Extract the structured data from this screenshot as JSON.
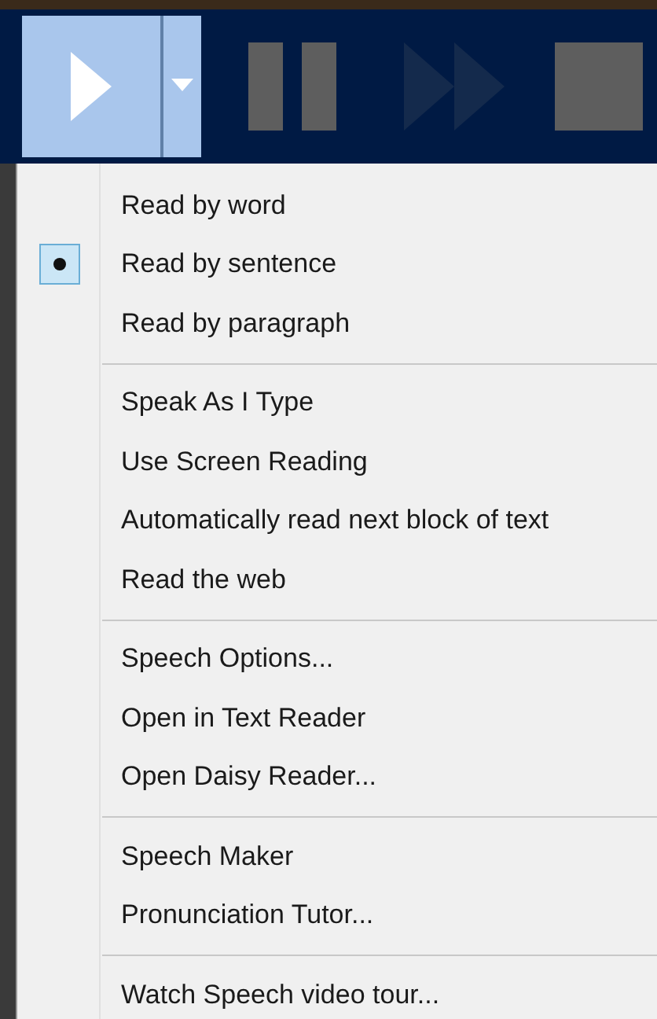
{
  "toolbar": {
    "buttons": [
      {
        "kind": "play",
        "hovered": true,
        "disabled": false
      },
      {
        "kind": "dropdown",
        "hovered": true,
        "disabled": false
      },
      {
        "kind": "pause",
        "hovered": false,
        "disabled": false
      },
      {
        "kind": "fast-forward",
        "hovered": false,
        "disabled": true
      },
      {
        "kind": "stop",
        "hovered": false,
        "disabled": false
      }
    ]
  },
  "menu": {
    "groups": [
      {
        "items": [
          {
            "label": "Read by word",
            "selected": false
          },
          {
            "label": "Read by sentence",
            "selected": true
          },
          {
            "label": "Read by paragraph",
            "selected": false
          }
        ]
      },
      {
        "items": [
          {
            "label": "Speak As I Type"
          },
          {
            "label": "Use Screen Reading"
          },
          {
            "label": "Automatically read next block of text"
          },
          {
            "label": "Read the web"
          }
        ]
      },
      {
        "items": [
          {
            "label": "Speech Options..."
          },
          {
            "label": "Open in Text Reader"
          },
          {
            "label": "Open Daisy Reader..."
          }
        ]
      },
      {
        "items": [
          {
            "label": "Speech Maker"
          },
          {
            "label": "Pronunciation Tutor..."
          }
        ]
      },
      {
        "items": [
          {
            "label": "Watch Speech video tour..."
          }
        ]
      }
    ]
  }
}
